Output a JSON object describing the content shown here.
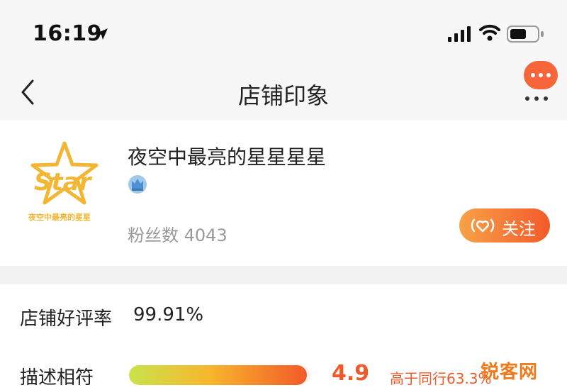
{
  "status_bar": {
    "time": "16:19"
  },
  "nav": {
    "title": "店铺印象"
  },
  "shop": {
    "logo_text": "Star",
    "logo_subtext": "夜空中最亮的星星",
    "name": "夜空中最亮的星星星星",
    "fans_label": "粉丝数",
    "fans_count": "4043",
    "follow_label": "关注"
  },
  "ratings": {
    "good_rate_label": "店铺好评率",
    "good_rate_value": "99.91%",
    "items": [
      {
        "label": "描述相符",
        "score": "4.9",
        "fill_fraction": 0.98,
        "compare": "高于同行63.3%"
      }
    ]
  },
  "watermark": "锐客网",
  "colors": {
    "accent": "#f35a2a",
    "logo": "#f2b632"
  }
}
